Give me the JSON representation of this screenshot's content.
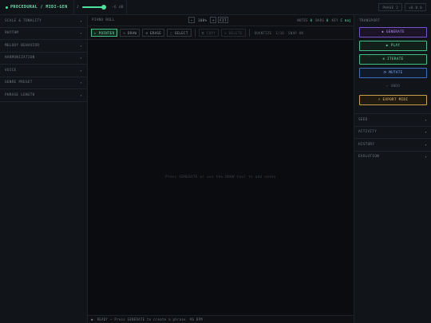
{
  "app": {
    "title": "PROCEDURAL / MIDI-GEN",
    "phase": "PHASE 2",
    "version": "v0.0.0"
  },
  "volume": {
    "icon": "speaker-icon",
    "value_label": "-6 dB",
    "level": 0.88
  },
  "left_panel": {
    "sections": [
      {
        "label": "SCALE & TONALITY"
      },
      {
        "label": "RHYTHM"
      },
      {
        "label": "MELODY BEHAVIOR"
      },
      {
        "label": "HARMONIZATION"
      },
      {
        "label": "VOICE"
      },
      {
        "label": "GENRE PRESET"
      },
      {
        "label": "PHRASE LENGTH"
      }
    ]
  },
  "piano_roll": {
    "title": "PIANO ROLL",
    "zoom_out": "−",
    "zoom_value": "100%",
    "zoom_in": "+",
    "fit": "FIT",
    "notes_label": "NOTES",
    "notes_value": "0",
    "bars_label": "BARS",
    "bars_value": "0",
    "key_label": "KEY",
    "key_value": "C maj",
    "hint": "Press GENERATE or use the DRAW tool to add notes"
  },
  "toolbar": {
    "pointer": "▸ POINTER",
    "draw": "✎ DRAW",
    "erase": "⌫ ERASE",
    "select": "⬚ SELECT",
    "copy": "⧉ COPY",
    "delete": "✕ DELETE",
    "quantize": "QUANTIZE",
    "q_value": "1/16",
    "snap": "SNAP",
    "snap_value": "ON"
  },
  "status": {
    "icon": "●",
    "text": "READY — Press GENERATE to create a phrase",
    "bpm": "96 BPM"
  },
  "transport": {
    "title": "TRANSPORT",
    "generate": "◆ GENERATE",
    "play": "▶ PLAY",
    "iterate": "⊕ ITERATE",
    "mutate": "⟳ MUTATE",
    "undo": "↶ UNDO",
    "export": "⬇ EXPORT MIDI"
  },
  "right_sections": [
    {
      "label": "SEED"
    },
    {
      "label": "ACTIVITY"
    },
    {
      "label": "HISTORY"
    },
    {
      "label": "EVOLUTION"
    }
  ],
  "colors": {
    "accent": "#4fe3a0",
    "generate": "#b78cff",
    "mutate": "#7aa9ff",
    "export": "#e3c27a"
  }
}
